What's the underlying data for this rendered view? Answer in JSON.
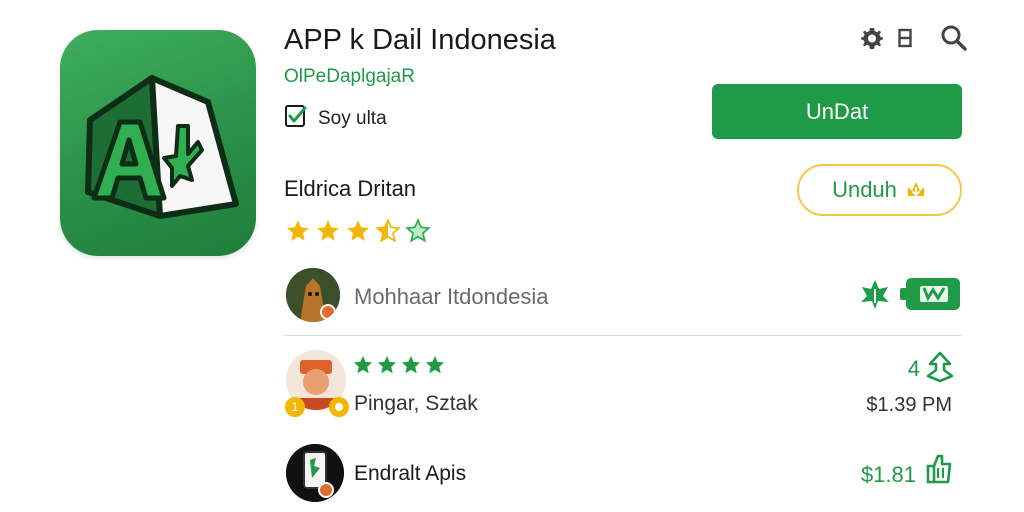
{
  "app": {
    "title": "APP k Dail Indonesia",
    "developer": "OlPeDaplgajaR",
    "verified_label": "Soy ulta",
    "icon": "app-logo-a-icon"
  },
  "actions": {
    "update_label": "UnDat",
    "download_label": "Unduh",
    "settings_icon": "gear-icon",
    "menu_icon": "bookmark-icon",
    "search_icon": "search-icon"
  },
  "rating_section": {
    "title": "Eldrica Dritan",
    "stars": 3.5
  },
  "publisher": {
    "name": "Mohhaar Itdondesia",
    "avatar_icon": "publisher-avatar-icon",
    "badge_icon": "leaf-icon"
  },
  "review": {
    "stars": 4,
    "count": "4",
    "name": "Pingar, Sztak",
    "price": "$1.39 PM"
  },
  "related_app": {
    "name": "Endralt Apis",
    "price": "$1.81"
  },
  "colors": {
    "brand_green": "#1f9a46",
    "star_gold": "#f2b705",
    "outline_gold": "#f2c84b"
  }
}
